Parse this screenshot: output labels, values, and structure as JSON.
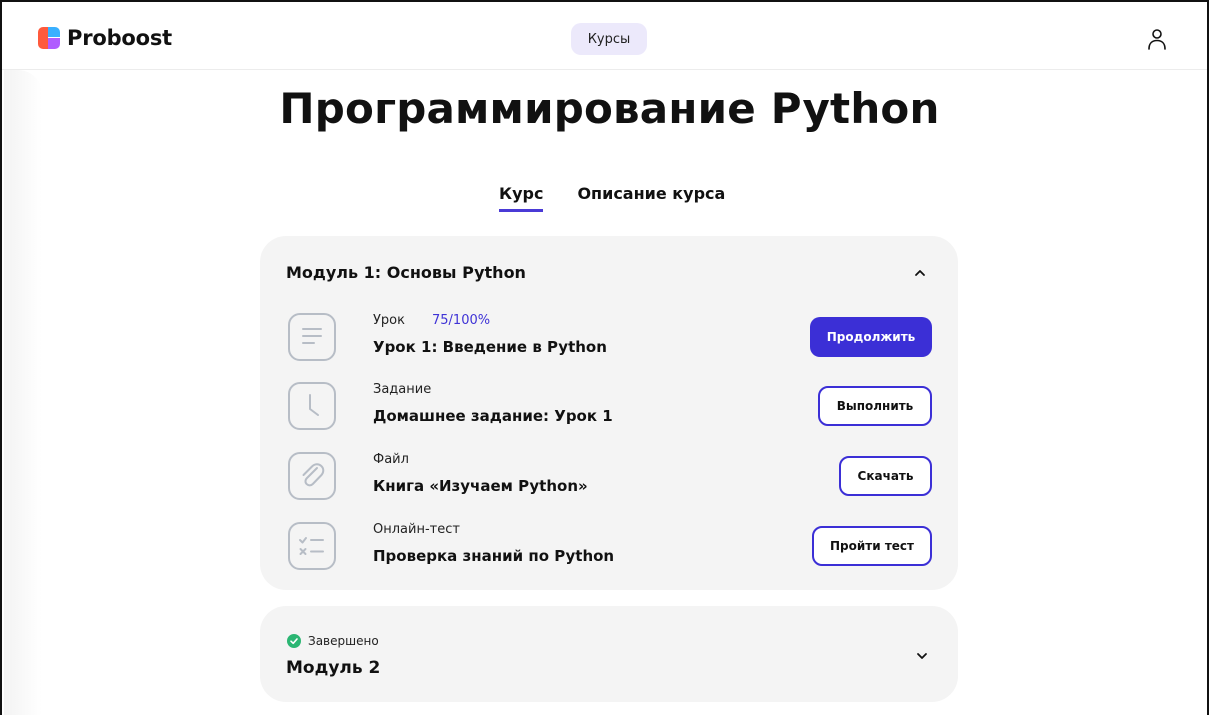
{
  "header": {
    "brand": "Proboost",
    "nav_label": "Курсы"
  },
  "page": {
    "title": "Программирование Python"
  },
  "tabs": [
    {
      "label": "Курс",
      "active": true
    },
    {
      "label": "Описание курса",
      "active": false
    }
  ],
  "module1": {
    "title": "Модуль 1: Основы Python",
    "expanded": true,
    "items": [
      {
        "icon": "document-lines-icon",
        "type": "Урок",
        "progress": "75/100%",
        "name": "Урок 1: Введение в Python",
        "action": "Продолжить",
        "action_style": "primary"
      },
      {
        "icon": "clock-icon",
        "type": "Задание",
        "name": "Домашнее задание: Урок 1",
        "action": "Выполнить",
        "action_style": "outline"
      },
      {
        "icon": "paperclip-icon",
        "type": "Файл",
        "name": "Книга «Изучаем Python»",
        "action": "Скачать",
        "action_style": "outline"
      },
      {
        "icon": "checklist-icon",
        "type": "Онлайн-тест",
        "name": "Проверка знаний по Python",
        "action": "Пройти тест",
        "action_style": "outline"
      }
    ]
  },
  "module2": {
    "status": "Завершено",
    "title": "Модуль 2",
    "expanded": false
  },
  "colors": {
    "accent": "#3b2fd6",
    "card_bg": "#f4f4f4",
    "nav_pill_bg": "#ece9fb",
    "success": "#2bb673"
  }
}
